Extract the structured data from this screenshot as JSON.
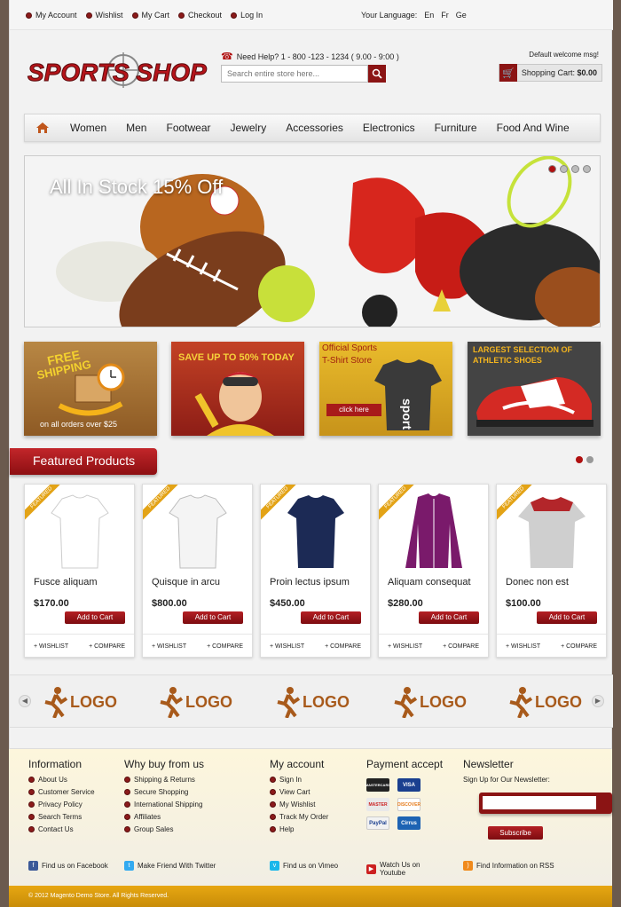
{
  "toplinks": [
    "My Account",
    "Wishlist",
    "My Cart",
    "Checkout",
    "Log In"
  ],
  "language": {
    "label": "Your Language:",
    "options": [
      "En",
      "Fr",
      "Ge"
    ]
  },
  "logo_text": "SPORTS SHOP",
  "help": "Need Help? 1 - 800 -123 - 1234 ( 9.00 - 9:00 )",
  "search": {
    "placeholder": "Search entire store here..."
  },
  "welcome": "Default welcome msg!",
  "cart": {
    "label": "Shopping Cart:",
    "amount": "$0.00"
  },
  "nav": [
    "Women",
    "Men",
    "Footwear",
    "Jewelry",
    "Accessories",
    "Electronics",
    "Furniture",
    "Food And Wine"
  ],
  "slider": {
    "title": "All In Stock 15% Off"
  },
  "promos": {
    "free_shipping": {
      "line1": "FREE",
      "line2": "SHIPPING",
      "sub": "on all orders over $25"
    },
    "save": {
      "text": "SAVE UP TO 50% TODAY"
    },
    "tshirt": {
      "line1": "Official Sports",
      "line2": "T-Shirt Store",
      "button": "click here"
    },
    "shoes": {
      "line1": "LARGEST SELECTION OF",
      "line2": "ATHLETIC SHOES"
    }
  },
  "featured_title": "Featured Products",
  "products": [
    {
      "badge": "FEATURED",
      "name": "Fusce aliquam",
      "price": "$170.00",
      "color": "#ffffff",
      "add": "Add to Cart",
      "wishlist": "+ WISHLIST",
      "compare": "+ COMPARE"
    },
    {
      "badge": "FEATURED",
      "name": "Quisque in arcu",
      "price": "$800.00",
      "color": "#f4f4f4",
      "add": "Add to Cart",
      "wishlist": "+ WISHLIST",
      "compare": "+ COMPARE"
    },
    {
      "badge": "FEATURED",
      "name": "Proin lectus ipsum",
      "price": "$450.00",
      "color": "#1c2a55",
      "add": "Add to Cart",
      "wishlist": "+ WISHLIST",
      "compare": "+ COMPARE"
    },
    {
      "badge": "FEATURED",
      "name": "Aliquam consequat",
      "price": "$280.00",
      "color": "#7a1a6b",
      "add": "Add to Cart",
      "wishlist": "+ WISHLIST",
      "compare": "+ COMPARE"
    },
    {
      "badge": "FEATURED",
      "name": "Donec non est",
      "price": "$100.00",
      "color": "#c8c8c8",
      "add": "Add to Cart",
      "wishlist": "+ WISHLIST",
      "compare": "+ COMPARE"
    }
  ],
  "brand_logo": "LOGO",
  "footer": {
    "information": {
      "title": "Information",
      "links": [
        "About Us",
        "Customer Service",
        "Privacy Policy",
        "Search Terms",
        "Contact Us"
      ]
    },
    "why": {
      "title": "Why buy from us",
      "links": [
        "Shipping & Returns",
        "Secure Shopping",
        "International Shipping",
        "Affiliates",
        "Group Sales"
      ]
    },
    "account": {
      "title": "My account",
      "links": [
        "Sign In",
        "View Cart",
        "My Wishlist",
        "Track My Order",
        "Help"
      ]
    },
    "payment": {
      "title": "Payment accept",
      "cards": [
        "MASTERCARD",
        "VISA",
        "MASTER",
        "DISCOVER",
        "PayPal",
        "Cirrus"
      ]
    },
    "newsletter": {
      "title": "Newsletter",
      "label": "Sign Up for Our Newsletter:",
      "button": "Subscribe"
    }
  },
  "social": [
    "Find us on Facebook",
    "Make Friend With Twitter",
    "Find us on Vimeo",
    "Watch Us on Youtube",
    "Find Information on RSS"
  ],
  "copyright": "© 2012 Magento Demo Store. All Rights Reserved."
}
